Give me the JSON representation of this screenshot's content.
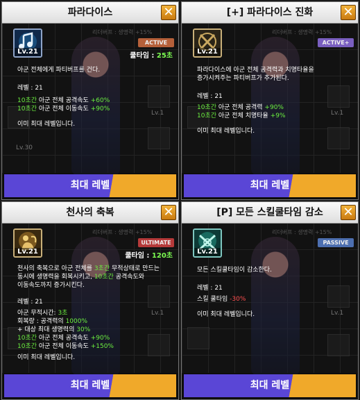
{
  "panels": [
    {
      "title": "파라다이스",
      "level_label": "Lv.21",
      "badge": "ACTIVE",
      "cooltime_label": "쿨타임 :",
      "cooltime_value": "25초",
      "description": "아군 전체에게 파티버프를 건다.",
      "level_line": "레벨 : 21",
      "effects": [
        {
          "time": "10초간",
          "text": " 아군 전체 공격속도 ",
          "value": "+60%"
        },
        {
          "time": "10초간",
          "text": " 아군 전체 이동속도 ",
          "value": "+90%"
        }
      ],
      "max_note": "이미 최대 레벨입니다.",
      "button": "최대 레벨"
    },
    {
      "title": "[+] 파라다이스 진화",
      "level_label": "Lv.21",
      "badge": "ACTIVE+",
      "description_1": "파라다이스에 아군 전체 공격력과 치명타율을",
      "description_2": "증가시켜주는 파티버프가 추가된다.",
      "level_line": "레벨 : 21",
      "effects": [
        {
          "time": "10초간",
          "text": " 아군 전체 공격력 ",
          "value": "+90%"
        },
        {
          "time": "10초간",
          "text": " 아군 전체 치명타율 ",
          "value": "+9%"
        }
      ],
      "max_note": "이미 최대 레벨입니다.",
      "button": "최대 레벨"
    },
    {
      "title": "천사의 축복",
      "level_label": "Lv.21",
      "badge": "ULTIMATE",
      "cooltime_label": "쿨타임 :",
      "cooltime_value": "120초",
      "description_1a": "천사의 축복으로 아군 전체를 ",
      "description_1b": "3초간",
      "description_1c": " 무적상태로 만드는",
      "description_2a": "동시에 생명력을 회복시키고, ",
      "description_2b": "10초간",
      "description_2c": " 공격속도와",
      "description_3": "이동속도까지 증가시킨다.",
      "level_line": "레벨 : 21",
      "invincible_label": "아군 무적시간: ",
      "invincible_value": "3초",
      "heal_label": "회복량 : 공격력의 ",
      "heal_value": "1000%",
      "extra_label": " + 대상 최대 생명력의 ",
      "extra_value": "30%",
      "effects": [
        {
          "time": "10초간",
          "text": " 아군 전체 공격속도 ",
          "value": "+90%"
        },
        {
          "time": "10초간",
          "text": " 아군 전체 이동속도 ",
          "value": "+150%"
        }
      ],
      "max_note": "이미 최대 레벨입니다.",
      "button": "최대 레벨"
    },
    {
      "title": "[P] 모든 스킬쿨타임 감소",
      "level_label": "Lv.21",
      "badge": "PASSIVE",
      "description": "모든 스킬쿨타임이 감소한다.",
      "level_line": "레벨 : 21",
      "effect_label": "스킬 쿨타임 ",
      "effect_value": "-30%",
      "max_note": "이미 최대 레벨입니다.",
      "button": "최대 레벨"
    }
  ],
  "background": {
    "caption": "리더버프 : 생명력 +15%",
    "level_tag": "Lv.1",
    "level_tag_30": "Lv.30"
  },
  "colors": {
    "active_badge": "#b5603a",
    "active_plus_badge": "#7a5fc0",
    "ultimate_badge": "#b53a3a",
    "passive_badge": "#4d6fb0",
    "green_text": "#6cf040",
    "red_text": "#ff5050",
    "button_blue": "#5a46d6",
    "button_orange": "#f0a92a"
  }
}
